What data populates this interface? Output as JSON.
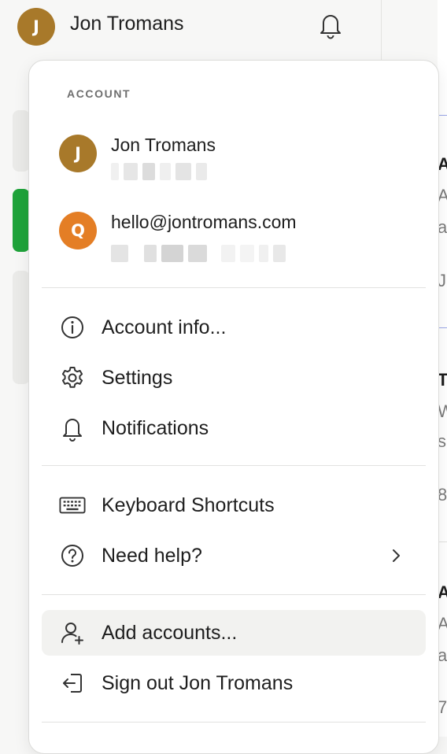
{
  "topbar": {
    "avatar_initial": "J",
    "user_name": "Jon Tromans"
  },
  "colors": {
    "avatar_j": "#a8792a",
    "avatar_q": "#e47e25",
    "accent_green": "#1fa33a"
  },
  "menu": {
    "section_label": "ACCOUNT",
    "accounts": [
      {
        "initial": "J",
        "name": "Jon Tromans"
      },
      {
        "initial": "Q",
        "name": "hello@jontromans.com"
      }
    ],
    "items_group1": [
      {
        "label": "Account info...",
        "icon": "info-icon"
      },
      {
        "label": "Settings",
        "icon": "gear-icon"
      },
      {
        "label": "Notifications",
        "icon": "bell-icon"
      }
    ],
    "items_group2": [
      {
        "label": "Keyboard Shortcuts",
        "icon": "keyboard-icon"
      },
      {
        "label": "Need help?",
        "icon": "question-icon"
      }
    ],
    "items_group3": [
      {
        "label": "Add accounts...",
        "icon": "add-user-icon"
      },
      {
        "label": "Sign out Jon Tromans",
        "icon": "sign-out-icon"
      }
    ]
  }
}
